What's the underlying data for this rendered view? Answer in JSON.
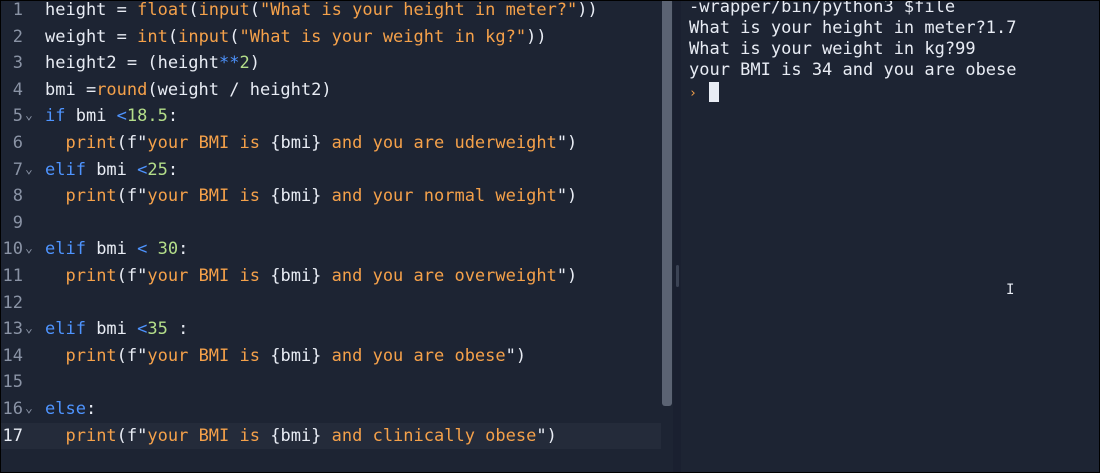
{
  "editor": {
    "active_line": 17,
    "lines": [
      {
        "num": "1",
        "fold": false,
        "tokens": [
          [
            "pl",
            "height = "
          ],
          [
            "fn",
            "float"
          ],
          [
            "pu",
            "("
          ],
          [
            "fn",
            "input"
          ],
          [
            "pu",
            "("
          ],
          [
            "str",
            "\"What is your height in meter?\""
          ],
          [
            "pu",
            "))"
          ]
        ]
      },
      {
        "num": "2",
        "fold": false,
        "tokens": [
          [
            "pl",
            "weight = "
          ],
          [
            "fn",
            "int"
          ],
          [
            "pu",
            "("
          ],
          [
            "fn",
            "input"
          ],
          [
            "pu",
            "("
          ],
          [
            "str",
            "\"What is your weight in kg?\""
          ],
          [
            "pu",
            "))"
          ]
        ]
      },
      {
        "num": "3",
        "fold": false,
        "tokens": [
          [
            "pl",
            "height2 = (height"
          ],
          [
            "op",
            "**"
          ],
          [
            "num",
            "2"
          ],
          [
            "pu",
            ")"
          ]
        ]
      },
      {
        "num": "4",
        "fold": false,
        "tokens": [
          [
            "pl",
            "bmi ="
          ],
          [
            "fn",
            "round"
          ],
          [
            "pu",
            "(weight / height2)"
          ]
        ]
      },
      {
        "num": "5",
        "fold": true,
        "tokens": [
          [
            "kw",
            "if"
          ],
          [
            "pl",
            " bmi "
          ],
          [
            "op",
            "<"
          ],
          [
            "num",
            "18.5"
          ],
          [
            "pu",
            ":"
          ]
        ]
      },
      {
        "num": "6",
        "fold": false,
        "tokens": [
          [
            "pl",
            "  "
          ],
          [
            "fn",
            "print"
          ],
          [
            "pu",
            "(f\""
          ],
          [
            "str",
            "your BMI is "
          ],
          [
            "pu",
            "{bmi}"
          ],
          [
            "str",
            " and you are uderweight"
          ],
          [
            "pu",
            "\")"
          ]
        ]
      },
      {
        "num": "7",
        "fold": true,
        "tokens": [
          [
            "kw",
            "elif"
          ],
          [
            "pl",
            " bmi "
          ],
          [
            "op",
            "<"
          ],
          [
            "num",
            "25"
          ],
          [
            "pu",
            ":"
          ]
        ]
      },
      {
        "num": "8",
        "fold": false,
        "tokens": [
          [
            "pl",
            "  "
          ],
          [
            "fn",
            "print"
          ],
          [
            "pu",
            "(f\""
          ],
          [
            "str",
            "your BMI is "
          ],
          [
            "pu",
            "{bmi}"
          ],
          [
            "str",
            " and your normal weight"
          ],
          [
            "pu",
            "\")"
          ]
        ]
      },
      {
        "num": "9",
        "fold": false,
        "tokens": []
      },
      {
        "num": "10",
        "fold": true,
        "tokens": [
          [
            "kw",
            "elif"
          ],
          [
            "pl",
            " bmi "
          ],
          [
            "op",
            "<"
          ],
          [
            "pl",
            " "
          ],
          [
            "num",
            "30"
          ],
          [
            "pu",
            ":"
          ]
        ]
      },
      {
        "num": "11",
        "fold": false,
        "tokens": [
          [
            "pl",
            "  "
          ],
          [
            "fn",
            "print"
          ],
          [
            "pu",
            "(f\""
          ],
          [
            "str",
            "your BMI is "
          ],
          [
            "pu",
            "{bmi}"
          ],
          [
            "str",
            " and you are overweight"
          ],
          [
            "pu",
            "\")"
          ]
        ]
      },
      {
        "num": "12",
        "fold": false,
        "tokens": []
      },
      {
        "num": "13",
        "fold": true,
        "tokens": [
          [
            "kw",
            "elif"
          ],
          [
            "pl",
            " bmi "
          ],
          [
            "op",
            "<"
          ],
          [
            "num",
            "35"
          ],
          [
            "pu",
            " :"
          ]
        ]
      },
      {
        "num": "14",
        "fold": false,
        "tokens": [
          [
            "pl",
            "  "
          ],
          [
            "fn",
            "print"
          ],
          [
            "pu",
            "(f\""
          ],
          [
            "str",
            "your BMI is "
          ],
          [
            "pu",
            "{bmi}"
          ],
          [
            "str",
            " and you are obese"
          ],
          [
            "pu",
            "\")"
          ]
        ]
      },
      {
        "num": "15",
        "fold": false,
        "tokens": []
      },
      {
        "num": "16",
        "fold": true,
        "tokens": [
          [
            "kw",
            "else"
          ],
          [
            "pu",
            ":"
          ]
        ]
      },
      {
        "num": "17",
        "fold": false,
        "tokens": [
          [
            "pl",
            "  "
          ],
          [
            "fn",
            "print"
          ],
          [
            "pu",
            "(f\""
          ],
          [
            "str",
            "your BMI is "
          ],
          [
            "pu",
            "{bmi}"
          ],
          [
            "str",
            " and clinically obese"
          ],
          [
            "pu",
            "\")"
          ]
        ]
      }
    ]
  },
  "console": {
    "lines": [
      "-wrapper/bin/python3 $file",
      "What is your height in meter?1.7",
      "What is your weight in kg?99",
      "your BMI is 34 and you are obese"
    ],
    "prompt_glyph": "›",
    "fold_glyph": "⌄"
  },
  "colors": {
    "background": "#1d2433",
    "keyword": "#4e94ff",
    "function": "#f5a14a",
    "string": "#f5a14a",
    "number": "#b4de8a",
    "text": "#e8ecf4",
    "gutter": "#8a93a5"
  }
}
